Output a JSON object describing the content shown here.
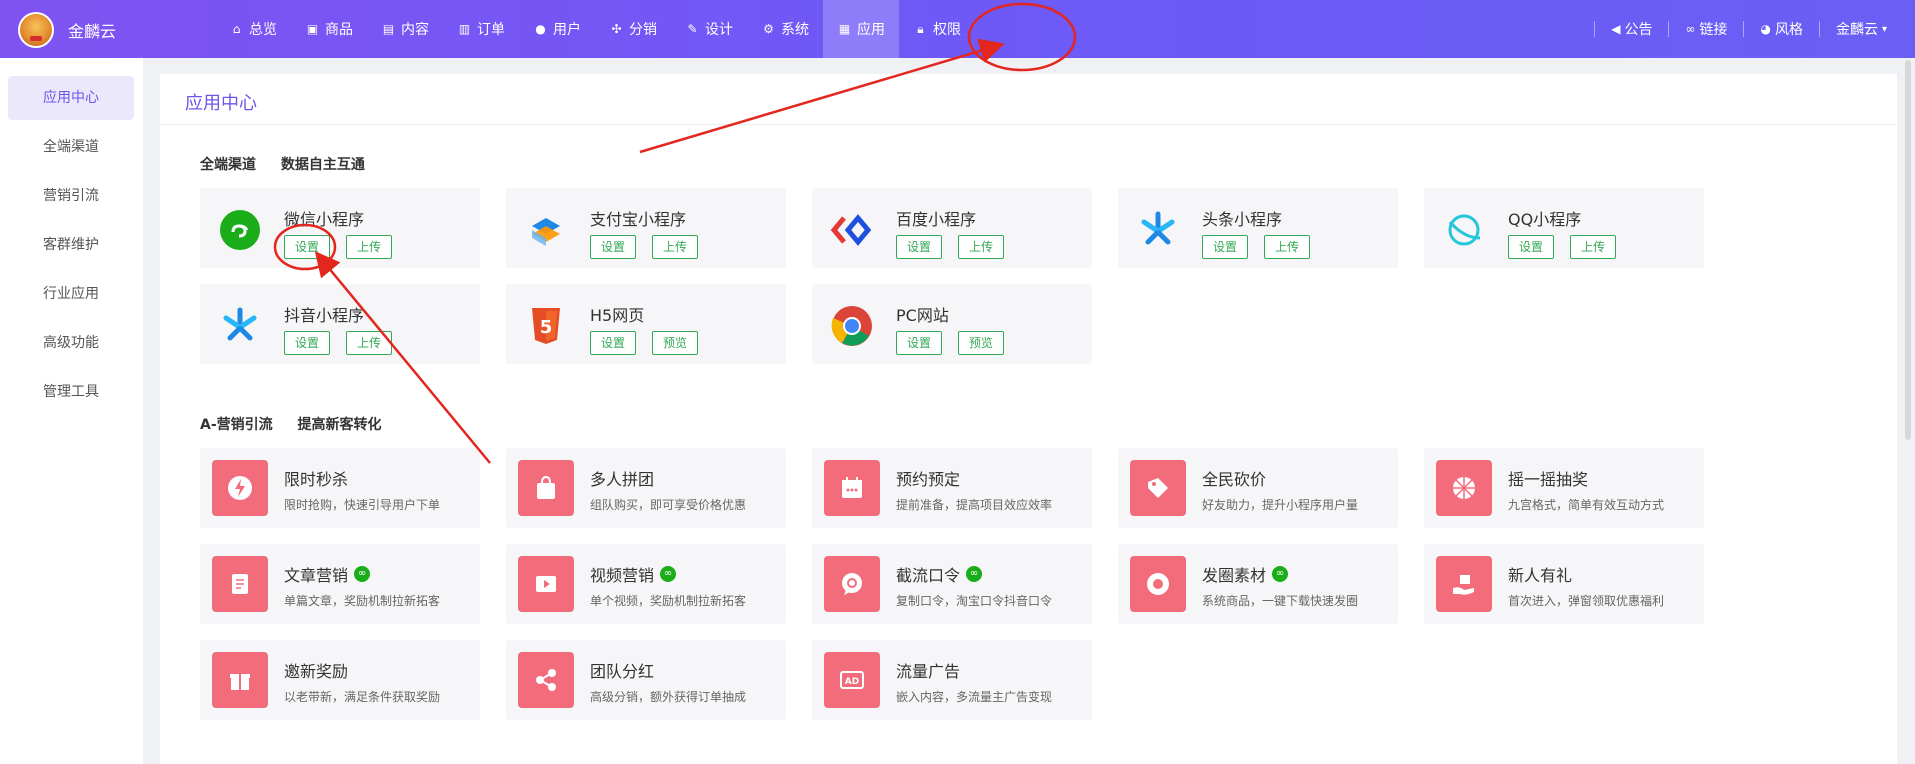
{
  "brand": {
    "name": "金麟云"
  },
  "nav": {
    "items": [
      {
        "label": "总览",
        "icon": "home-icon"
      },
      {
        "label": "商品",
        "icon": "bag-icon"
      },
      {
        "label": "内容",
        "icon": "document-icon"
      },
      {
        "label": "订单",
        "icon": "clipboard-icon"
      },
      {
        "label": "用户",
        "icon": "user-icon"
      },
      {
        "label": "分销",
        "icon": "share-icon"
      },
      {
        "label": "设计",
        "icon": "brush-icon"
      },
      {
        "label": "系统",
        "icon": "gear-icon"
      },
      {
        "label": "应用",
        "icon": "grid-icon",
        "active": true
      },
      {
        "label": "权限",
        "icon": "lock-icon"
      }
    ],
    "right": [
      {
        "label": "公告",
        "icon": "megaphone-icon"
      },
      {
        "label": "链接",
        "icon": "link-icon"
      },
      {
        "label": "风格",
        "icon": "palette-icon"
      }
    ],
    "account": "金麟云"
  },
  "sidebar": {
    "items": [
      {
        "label": "应用中心",
        "active": true
      },
      {
        "label": "全端渠道"
      },
      {
        "label": "营销引流"
      },
      {
        "label": "客群维护"
      },
      {
        "label": "行业应用"
      },
      {
        "label": "高级功能"
      },
      {
        "label": "管理工具"
      }
    ]
  },
  "main": {
    "title": "应用中心",
    "channels": {
      "heading": "全端渠道",
      "subheading": "数据自主互通",
      "cards": [
        {
          "name": "微信小程序",
          "icon": "wechat-miniprogram-icon",
          "btn1": "设置",
          "btn2": "上传"
        },
        {
          "name": "支付宝小程序",
          "icon": "alipay-miniprogram-icon",
          "btn1": "设置",
          "btn2": "上传"
        },
        {
          "name": "百度小程序",
          "icon": "baidu-miniprogram-icon",
          "btn1": "设置",
          "btn2": "上传"
        },
        {
          "name": "头条小程序",
          "icon": "toutiao-miniprogram-icon",
          "btn1": "设置",
          "btn2": "上传"
        },
        {
          "name": "QQ小程序",
          "icon": "qq-miniprogram-icon",
          "btn1": "设置",
          "btn2": "上传"
        },
        {
          "name": "抖音小程序",
          "icon": "douyin-miniprogram-icon",
          "btn1": "设置",
          "btn2": "上传"
        },
        {
          "name": "H5网页",
          "icon": "html5-icon",
          "btn1": "设置",
          "btn2": "预览"
        },
        {
          "name": "PC网站",
          "icon": "chrome-icon",
          "btn1": "设置",
          "btn2": "预览"
        }
      ]
    },
    "marketing": {
      "heading": "A-营销引流",
      "subheading": "提高新客转化",
      "cards": [
        {
          "name": "限时秒杀",
          "desc": "限时抢购，快速引导用户下单",
          "icon": "lightning-icon"
        },
        {
          "name": "多人拼团",
          "desc": "组队购买，即可享受价格优惠",
          "icon": "shopping-bag-icon"
        },
        {
          "name": "预约预定",
          "desc": "提前准备，提高项目效应效率",
          "icon": "calendar-icon"
        },
        {
          "name": "全民砍价",
          "desc": "好友助力，提升小程序用户量",
          "icon": "bargain-tag-icon"
        },
        {
          "name": "摇一摇抽奖",
          "desc": "九宫格式，简单有效互动方式",
          "icon": "lottery-wheel-icon"
        },
        {
          "name": "文章营销",
          "desc": "单篇文章，奖励机制拉新拓客",
          "icon": "article-icon",
          "wx": "∞"
        },
        {
          "name": "视频营销",
          "desc": "单个视频，奖励机制拉新拓客",
          "icon": "video-icon",
          "wx": "∞"
        },
        {
          "name": "截流口令",
          "desc": "复制口令，淘宝口令抖音口令",
          "icon": "chat-bubble-icon",
          "wx": "∞"
        },
        {
          "name": "发圈素材",
          "desc": "系统商品，一键下载快速发圈",
          "icon": "camera-aperture-icon",
          "wx": "∞"
        },
        {
          "name": "新人有礼",
          "desc": "首次进入，弹窗领取优惠福利",
          "icon": "gift-hand-icon"
        },
        {
          "name": "邀新奖励",
          "desc": "以老带新，满足条件获取奖励",
          "icon": "gift-box-icon"
        },
        {
          "name": "团队分红",
          "desc": "高级分销，额外获得订单抽成",
          "icon": "share-nodes-icon"
        },
        {
          "name": "流量广告",
          "desc": "嵌入内容，多流量主广告变现",
          "icon": "ad-icon",
          "adtext": "AD"
        }
      ]
    }
  },
  "colors": {
    "accent": "#6c55e8",
    "green": "#34a853",
    "marketing_icon": "#f26c7c",
    "annotation": "#e3261e"
  }
}
